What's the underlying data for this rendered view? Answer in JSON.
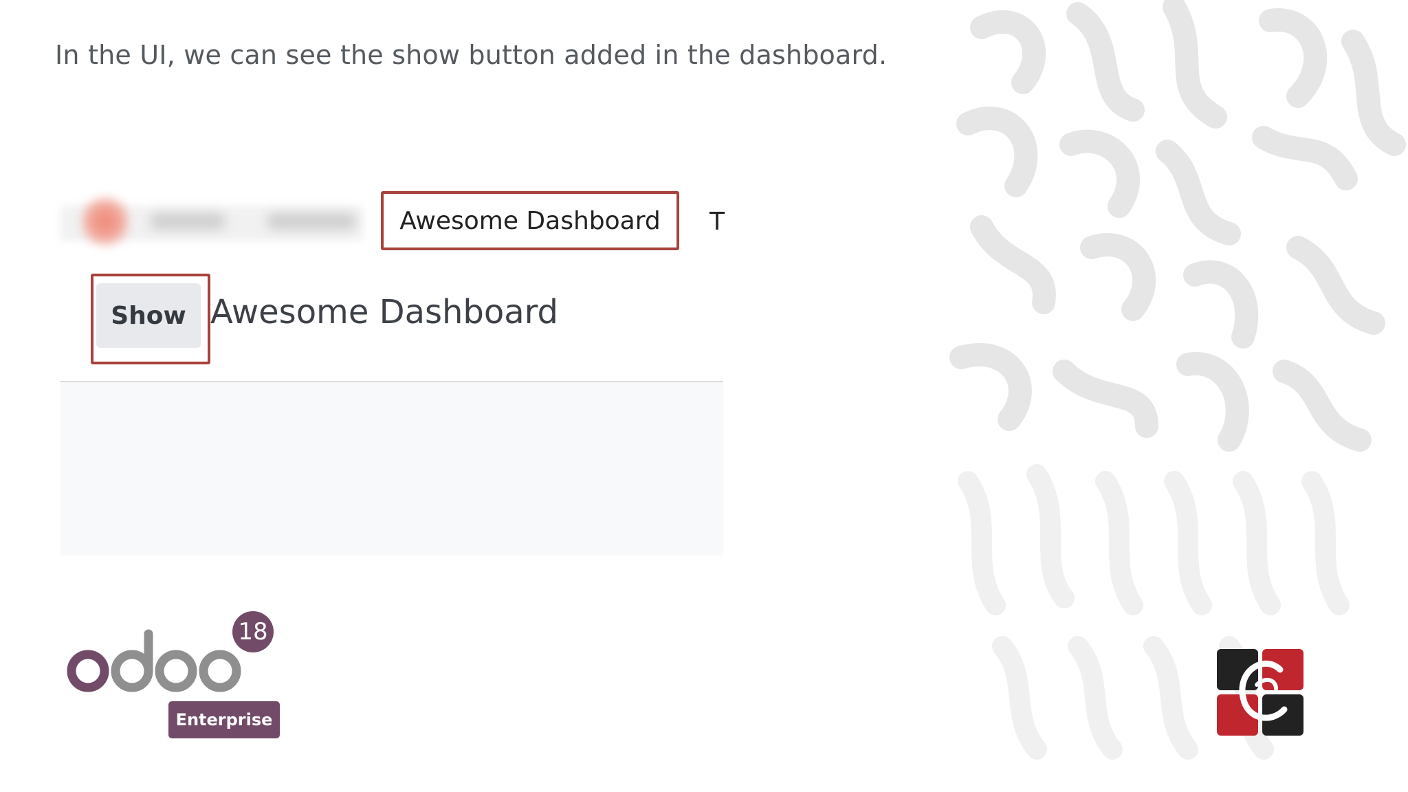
{
  "caption": "In the UI, we can see the show button added in the dashboard.",
  "navbar": {
    "active_tab_label": "Awesome Dashboard",
    "next_tab_partial": "T"
  },
  "dashboard": {
    "show_button_label": "Show",
    "title": "Awesome Dashboard"
  },
  "odoo_logo": {
    "wordmark": "odoo",
    "version_badge": "18",
    "edition": "Enterprise"
  },
  "colors": {
    "highlight_border": "#a8423c",
    "odoo_purple": "#714b67",
    "odoo_grey": "#8f8f8f",
    "brand_red": "#c0262d",
    "brand_dark": "#222222"
  },
  "icons": {
    "brand_logo": "cybrosys-logo-icon"
  }
}
